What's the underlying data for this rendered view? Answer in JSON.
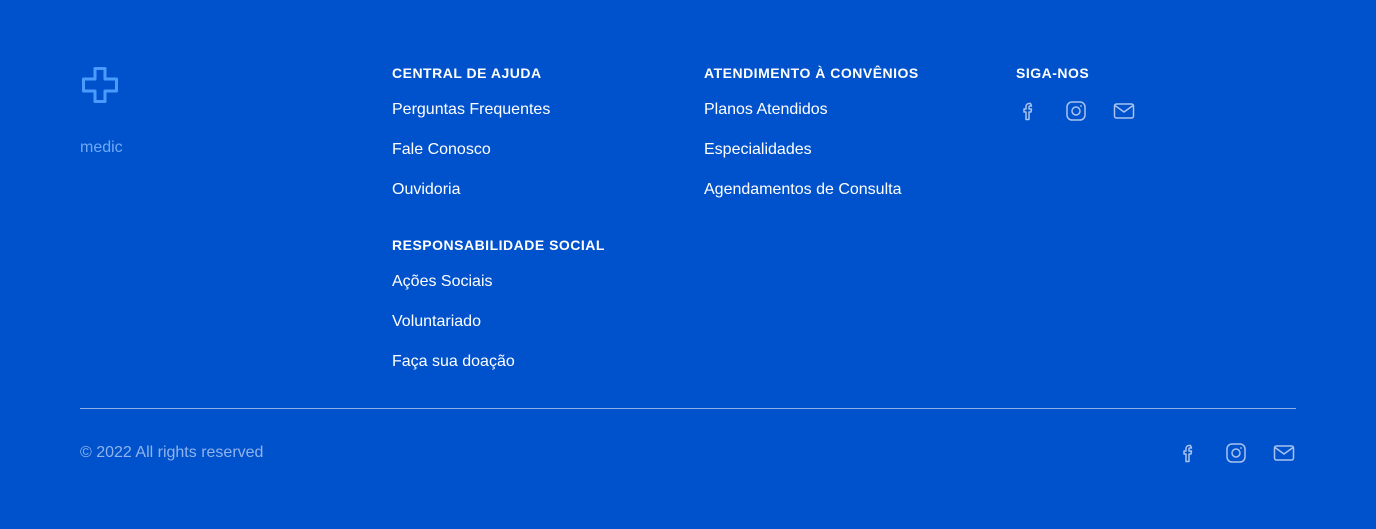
{
  "brand": {
    "name": "medic",
    "logo_icon": "medical-cross-icon",
    "accent": "#4b9bff"
  },
  "colors": {
    "background": "#0052cc",
    "muted_text": "#8fb3ec",
    "icon": "#a9c3ef"
  },
  "help_center": {
    "title": "CENTRAL DE AJUDA",
    "links": [
      "Perguntas Frequentes",
      "Fale Conosco",
      "Ouvidoria"
    ]
  },
  "social_responsibility": {
    "title": "RESPONSABILIDADE SOCIAL",
    "links": [
      "Ações Sociais",
      "Voluntariado",
      "Faça sua doação"
    ]
  },
  "insurance": {
    "title": "ATENDIMENTO À CONVÊNIOS",
    "links": [
      "Planos Atendidos",
      "Especialidades",
      "Agendamentos de Consulta"
    ]
  },
  "follow": {
    "title": "SIGA-NOS",
    "icons": [
      "facebook-icon",
      "instagram-icon",
      "mail-icon"
    ]
  },
  "bottom": {
    "copyright": "© 2022 All rights reserved",
    "icons": [
      "facebook-icon",
      "instagram-icon",
      "mail-icon"
    ]
  }
}
